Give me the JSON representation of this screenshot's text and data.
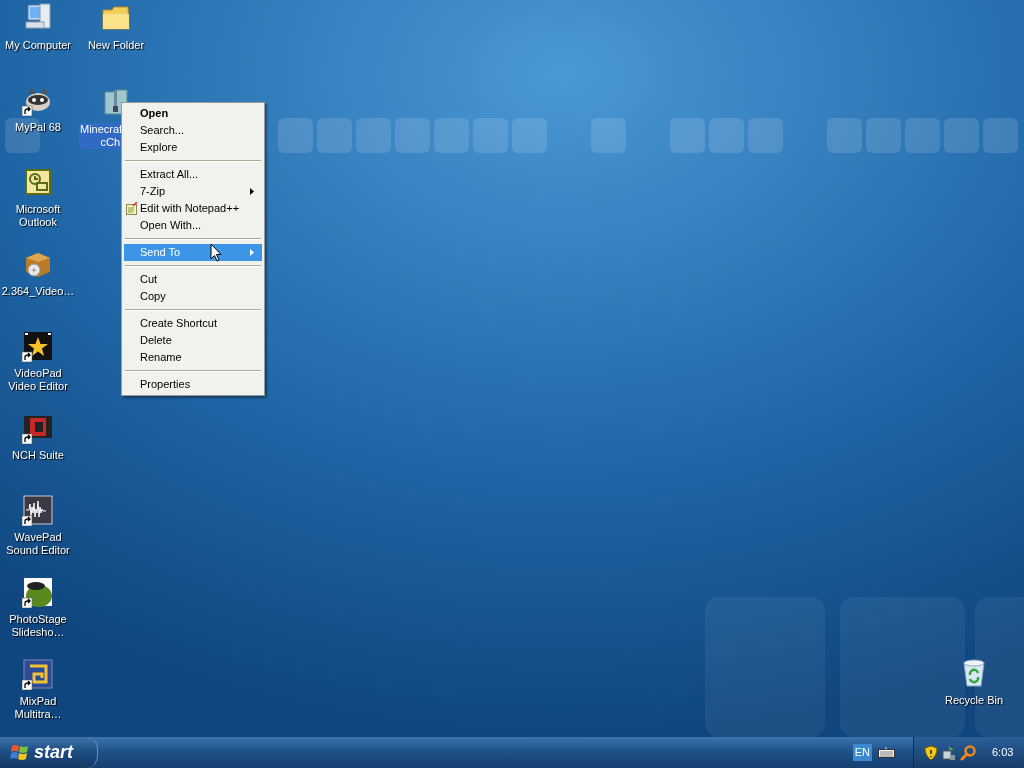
{
  "desktop": {
    "column_1": [
      {
        "label": "My Computer",
        "kind": "computer",
        "shortcut": false,
        "selected": false
      },
      {
        "label": "MyPal 68",
        "kind": "raccoon",
        "shortcut": true,
        "selected": false
      },
      {
        "label": "Microsoft Outlook",
        "kind": "outlook",
        "shortcut": false,
        "selected": false
      },
      {
        "label": "2.364_Video…",
        "kind": "package",
        "shortcut": false,
        "selected": false
      },
      {
        "label": "VideoPad Video Editor",
        "kind": "star",
        "shortcut": true,
        "selected": false
      },
      {
        "label": "NCH Suite",
        "kind": "nch",
        "shortcut": true,
        "selected": false
      },
      {
        "label": "WavePad Sound Editor",
        "kind": "wave",
        "shortcut": true,
        "selected": false
      },
      {
        "label": "PhotoStage Slidesho…",
        "kind": "photostage",
        "shortcut": true,
        "selected": false
      },
      {
        "label": "MixPad Multitra…",
        "kind": "mixpad",
        "shortcut": true,
        "selected": false
      }
    ],
    "column_2": [
      {
        "label": "New Folder",
        "kind": "folder",
        "shortcut": false,
        "selected": false
      },
      {
        "label": "Minecraf cCh",
        "kind": "zip",
        "shortcut": false,
        "selected": true
      }
    ],
    "recycle_bin": {
      "label": "Recycle Bin",
      "kind": "recycle",
      "shortcut": false,
      "selected": false
    }
  },
  "context_menu": {
    "items": [
      {
        "kind": "item",
        "label": "Open",
        "default": true,
        "submenu": false,
        "icon": false,
        "selected": false
      },
      {
        "kind": "item",
        "label": "Search...",
        "default": false,
        "submenu": false,
        "icon": false,
        "selected": false
      },
      {
        "kind": "item",
        "label": "Explore",
        "default": false,
        "submenu": false,
        "icon": false,
        "selected": false
      },
      {
        "kind": "separator"
      },
      {
        "kind": "item",
        "label": "Extract All...",
        "default": false,
        "submenu": false,
        "icon": false,
        "selected": false
      },
      {
        "kind": "item",
        "label": "7-Zip",
        "default": false,
        "submenu": true,
        "icon": false,
        "selected": false
      },
      {
        "kind": "item",
        "label": "Edit with Notepad++",
        "default": false,
        "submenu": false,
        "icon": true,
        "selected": false
      },
      {
        "kind": "item",
        "label": "Open With...",
        "default": false,
        "submenu": false,
        "icon": false,
        "selected": false
      },
      {
        "kind": "separator"
      },
      {
        "kind": "item",
        "label": "Send To",
        "default": false,
        "submenu": true,
        "icon": false,
        "selected": true
      },
      {
        "kind": "separator"
      },
      {
        "kind": "item",
        "label": "Cut",
        "default": false,
        "submenu": false,
        "icon": false,
        "selected": false
      },
      {
        "kind": "item",
        "label": "Copy",
        "default": false,
        "submenu": false,
        "icon": false,
        "selected": false
      },
      {
        "kind": "separator"
      },
      {
        "kind": "item",
        "label": "Create Shortcut",
        "default": false,
        "submenu": false,
        "icon": false,
        "selected": false
      },
      {
        "kind": "item",
        "label": "Delete",
        "default": false,
        "submenu": false,
        "icon": false,
        "selected": false
      },
      {
        "kind": "item",
        "label": "Rename",
        "default": false,
        "submenu": false,
        "icon": false,
        "selected": false
      },
      {
        "kind": "separator"
      },
      {
        "kind": "item",
        "label": "Properties",
        "default": false,
        "submenu": false,
        "icon": false,
        "selected": false
      }
    ]
  },
  "taskbar": {
    "start_label": "start",
    "language": "EN",
    "clock": "6:03"
  }
}
